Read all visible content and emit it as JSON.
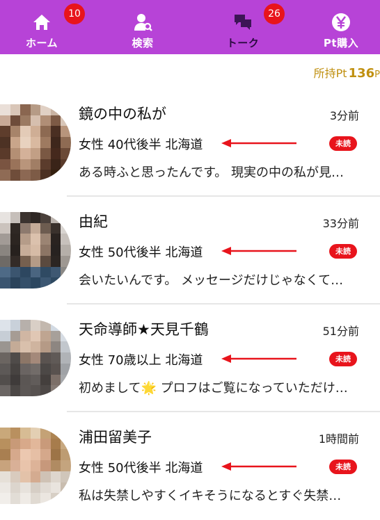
{
  "nav": {
    "items": [
      {
        "label": "ホーム",
        "icon": "home-icon",
        "badge": "10"
      },
      {
        "label": "検索",
        "icon": "user-search-icon",
        "badge": ""
      },
      {
        "label": "トーク",
        "icon": "chat-bubbles-icon",
        "badge": "26"
      },
      {
        "label": "Pt購入",
        "icon": "yen-coin-icon",
        "badge": ""
      }
    ],
    "background": "#b743d7",
    "badge_color": "#e8141c"
  },
  "points": {
    "label": "所持Pt",
    "value": "136",
    "unit": "P"
  },
  "messages": [
    {
      "name": "鏡の中の私が",
      "time": "3分前",
      "profile": "女性 40代後半 北海道",
      "status": "未読",
      "preview": "ある時ふと思ったんです。 現実の中の私が見…"
    },
    {
      "name": "由紀",
      "time": "33分前",
      "profile": "女性 50代後半 北海道",
      "status": "未読",
      "preview": "会いたいんです。 メッセージだけじゃなくて…"
    },
    {
      "name": "天命導師★天見千鶴",
      "time": "51分前",
      "profile": "女性 70歳以上 北海道",
      "status": "未読",
      "preview": "初めまして🌟 プロフはご覧になっていただけ…"
    },
    {
      "name": "浦田留美子",
      "time": "1時間前",
      "profile": "女性 50代後半 北海道",
      "status": "未読",
      "preview": "私は失禁しやすくイキそうになるとすぐ失禁…"
    }
  ],
  "colors": {
    "accent": "#b743d7",
    "unread": "#e8141c",
    "arrow": "#e8141c",
    "points": "#c09010"
  }
}
